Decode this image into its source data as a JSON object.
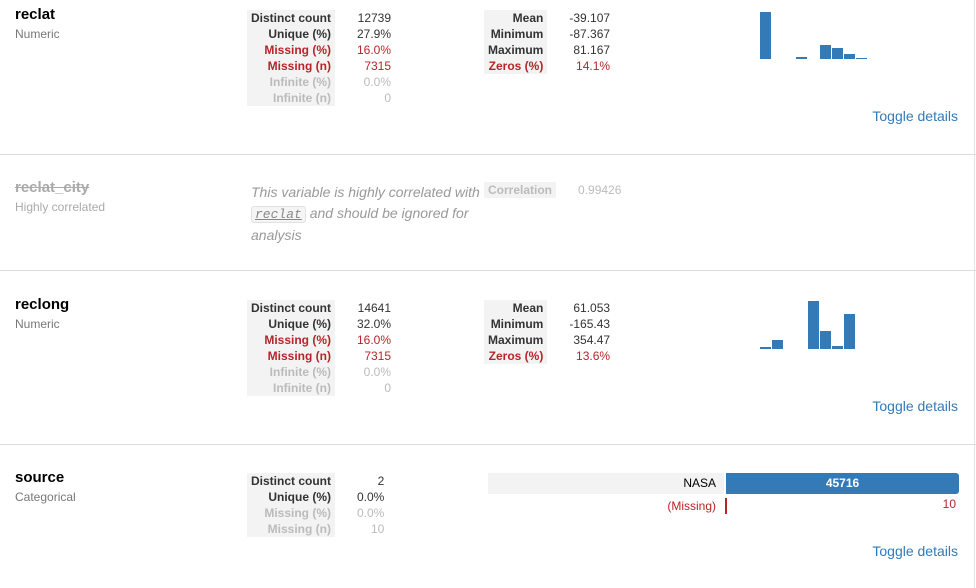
{
  "reclat": {
    "name": "reclat",
    "type": "Numeric",
    "stats_left": [
      {
        "key": "Distinct count",
        "value": "12739",
        "state": "normal"
      },
      {
        "key": "Unique (%)",
        "value": "27.9%",
        "state": "normal"
      },
      {
        "key": "Missing (%)",
        "value": "16.0%",
        "state": "alert"
      },
      {
        "key": "Missing (n)",
        "value": "7315",
        "state": "alert"
      },
      {
        "key": "Infinite (%)",
        "value": "0.0%",
        "state": "ignore"
      },
      {
        "key": "Infinite (n)",
        "value": "0",
        "state": "ignore"
      }
    ],
    "stats_right": [
      {
        "key": "Mean",
        "value": "-39.107",
        "state": "normal"
      },
      {
        "key": "Minimum",
        "value": "-87.367",
        "state": "normal"
      },
      {
        "key": "Maximum",
        "value": "81.167",
        "state": "normal"
      },
      {
        "key": "Zeros (%)",
        "value": "14.1%",
        "state": "alert"
      }
    ],
    "histogram": [
      1.0,
      0.0,
      0.0,
      0.05,
      0.0,
      0.3,
      0.23,
      0.1,
      0.02,
      0.0
    ],
    "toggle": "Toggle details"
  },
  "reclat_city": {
    "name": "reclat_city",
    "type": "Highly correlated",
    "message_before": "This variable is highly correlated with",
    "code": "reclat",
    "message_after": "and should be ignored for analysis",
    "correlation_label": "Correlation",
    "correlation_value": "0.99426"
  },
  "reclong": {
    "name": "reclong",
    "type": "Numeric",
    "stats_left": [
      {
        "key": "Distinct count",
        "value": "14641",
        "state": "normal"
      },
      {
        "key": "Unique (%)",
        "value": "32.0%",
        "state": "normal"
      },
      {
        "key": "Missing (%)",
        "value": "16.0%",
        "state": "alert"
      },
      {
        "key": "Missing (n)",
        "value": "7315",
        "state": "alert"
      },
      {
        "key": "Infinite (%)",
        "value": "0.0%",
        "state": "ignore"
      },
      {
        "key": "Infinite (n)",
        "value": "0",
        "state": "ignore"
      }
    ],
    "stats_right": [
      {
        "key": "Mean",
        "value": "61.053",
        "state": "normal"
      },
      {
        "key": "Minimum",
        "value": "-165.43",
        "state": "normal"
      },
      {
        "key": "Maximum",
        "value": "354.47",
        "state": "normal"
      },
      {
        "key": "Zeros (%)",
        "value": "13.6%",
        "state": "alert"
      }
    ],
    "histogram": [
      0.04,
      0.18,
      0.0,
      0.0,
      1.0,
      0.38,
      0.06,
      0.73,
      0.0,
      0.0
    ],
    "toggle": "Toggle details"
  },
  "source": {
    "name": "source",
    "type": "Categorical",
    "stats_left": [
      {
        "key": "Distinct count",
        "value": "2",
        "state": "normal"
      },
      {
        "key": "Unique (%)",
        "value": "0.0%",
        "state": "normal"
      },
      {
        "key": "Missing (%)",
        "value": "0.0%",
        "state": "ignore"
      },
      {
        "key": "Missing (n)",
        "value": "10",
        "state": "ignore"
      }
    ],
    "freq_label": "NASA",
    "freq_count": "45716",
    "freq_fraction": 1.0,
    "missing_label": "(Missing)",
    "missing_count": "10",
    "toggle": "Toggle details"
  },
  "colors": {
    "accent": "#337ab7",
    "alert": "#b5252a"
  }
}
